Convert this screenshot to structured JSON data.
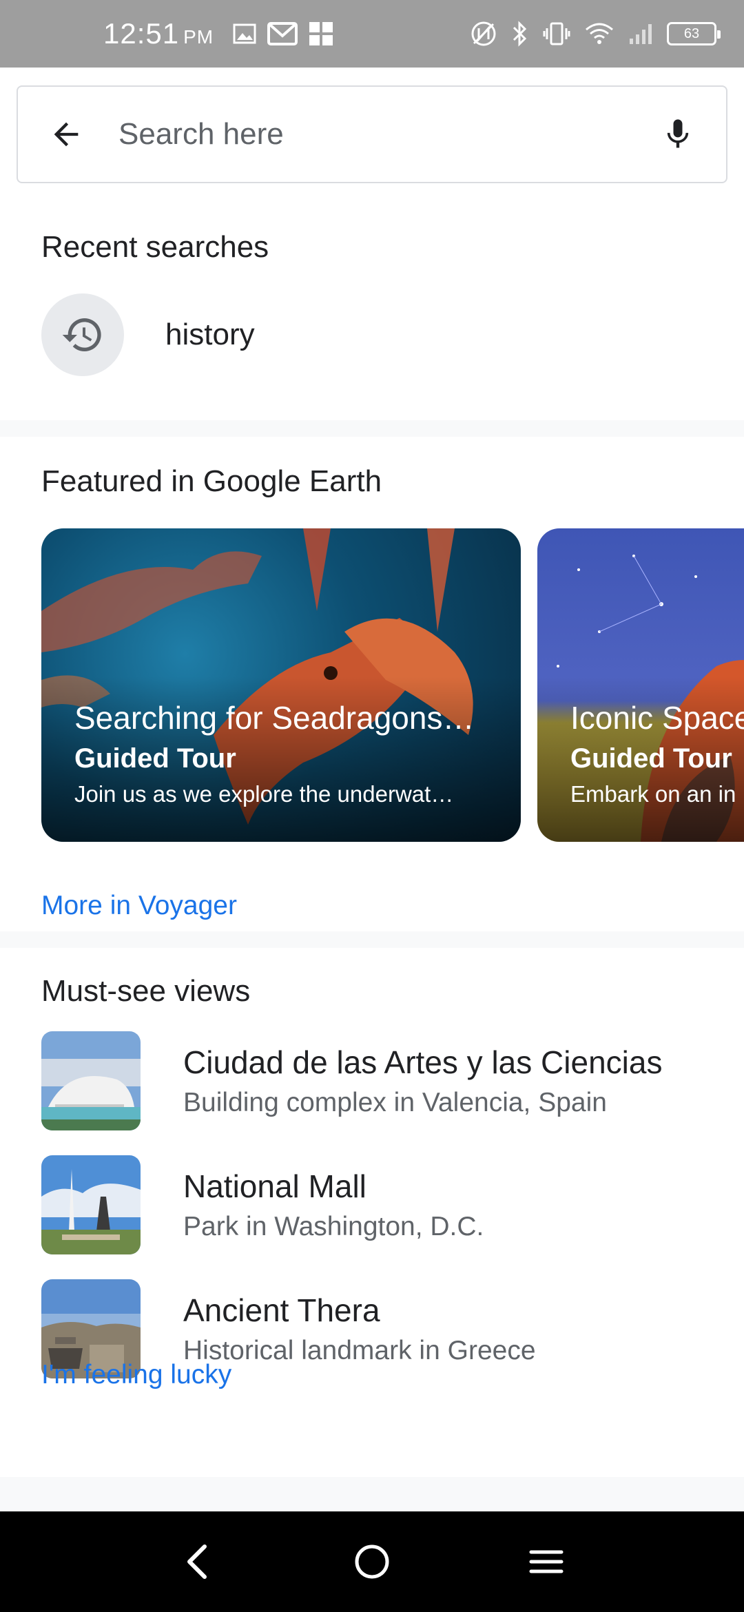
{
  "status_bar": {
    "time": "12:51",
    "ampm": "PM",
    "battery": "63"
  },
  "search": {
    "placeholder": "Search here"
  },
  "recent": {
    "title": "Recent searches",
    "items": [
      {
        "label": "history"
      }
    ]
  },
  "featured": {
    "title": "Featured in Google Earth",
    "cards": [
      {
        "title": "Searching for Seadragons…",
        "type": "Guided Tour",
        "description": "Join us as we explore the underwat…"
      },
      {
        "title": "Iconic Space",
        "type": "Guided Tour",
        "description": "Embark on an in"
      }
    ],
    "more_link": "More in Voyager"
  },
  "views": {
    "title": "Must-see views",
    "items": [
      {
        "name": "Ciudad de las Artes y las Ciencias",
        "subtitle": "Building complex in Valencia, Spain"
      },
      {
        "name": "National Mall",
        "subtitle": "Park in Washington, D.C."
      },
      {
        "name": "Ancient Thera",
        "subtitle": "Historical landmark in Greece"
      }
    ],
    "lucky_link": "I'm feeling lucky"
  }
}
